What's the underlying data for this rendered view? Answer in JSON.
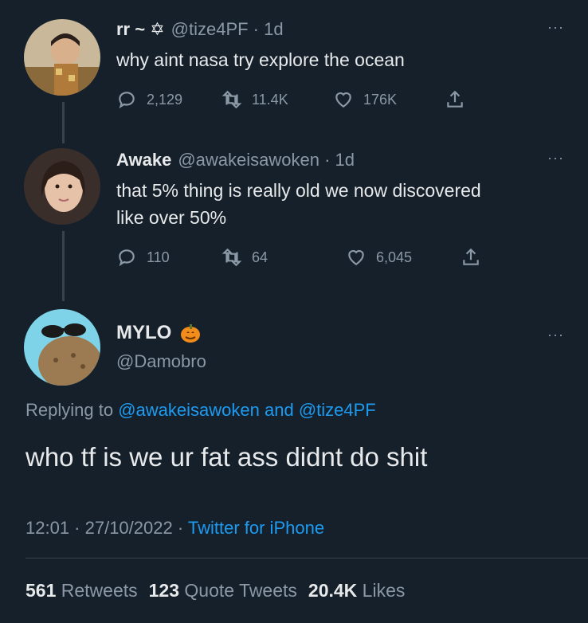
{
  "tweets": [
    {
      "name": "rr ~ ✡",
      "meta": "@tize4PF · 1d",
      "text": "why aint nasa try explore the ocean",
      "replies": "2,129",
      "retweets": "11.4K",
      "likes": "176K"
    },
    {
      "name": "Awake",
      "meta": "@awakeisawoken · 1d",
      "text_line1": "that 5% thing is really old we now discovered",
      "text_line2": "like over 50%",
      "replies": "110",
      "retweets": "64",
      "likes": "6,045"
    }
  ],
  "main": {
    "name": "MYLO",
    "handle": "@Damobro",
    "replying_prefix": "Replying to",
    "mention1": "@awakeisawoken",
    "and": "and",
    "mention2": "@tize4PF",
    "text": "who tf is we ur fat ass didnt do shit",
    "time": "12:01 · 27/10/2022 ·",
    "source": "Twitter for iPhone",
    "retweets_count": "561",
    "retweets_label": "Retweets",
    "quotes_count": "123",
    "quotes_label": "Quote Tweets",
    "likes_count": "20.4K",
    "likes_label": "Likes"
  },
  "more_label": "···",
  "icons": {
    "reply": "reply-icon",
    "retweet": "retweet-icon",
    "like": "heart-icon",
    "share": "share-icon",
    "pumpkin": "pumpkin-emoji-icon"
  },
  "colors": {
    "background": "#15202b",
    "link": "#1d9bf0",
    "muted": "#8b98a5",
    "text": "#e7e9ea"
  }
}
